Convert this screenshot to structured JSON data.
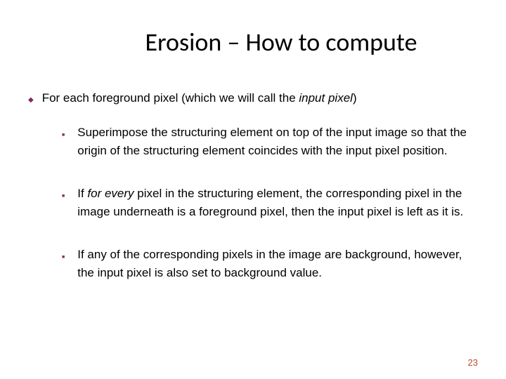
{
  "title": "Erosion – How to compute",
  "level1": {
    "pre": "For each foreground pixel (which we will call the ",
    "em": "input pixel",
    "post": ")"
  },
  "bullets": [
    "Superimpose the structuring element on top of the input image so that the origin of the structuring element coincides with the input pixel position.",
    {
      "pre": "If ",
      "em": "for every",
      "post": " pixel in the structuring element, the corresponding pixel in the image underneath is a foreground pixel, then the input pixel is left as it is."
    },
    "If any of the corresponding pixels in the image are background, however, the input pixel is also set to background value."
  ],
  "pageNumber": "23"
}
